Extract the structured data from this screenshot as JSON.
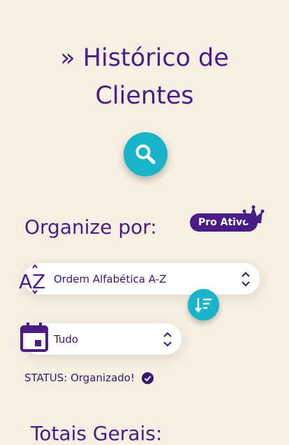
{
  "header": {
    "title_line1": "» Histórico de",
    "title_line2": "Clientes"
  },
  "search": {
    "icon": "search-icon",
    "color": "#17b4cc"
  },
  "organize": {
    "label": "Organize por:",
    "pro_badge": "Pro Ativo",
    "order_select": {
      "value": "Ordem Alfabética A-Z",
      "icon": "sort-alpha-az-icon"
    },
    "sort_button": {
      "icon": "sort-descending-icon"
    },
    "period_select": {
      "value": "Tudo",
      "icon": "calendar-icon"
    },
    "status": "STATUS: Organizado!"
  },
  "totals": {
    "title": "Totais Gerais:"
  },
  "colors": {
    "primary": "#4a1d86",
    "accent": "#17b4cc",
    "background": "#f6efe2"
  }
}
